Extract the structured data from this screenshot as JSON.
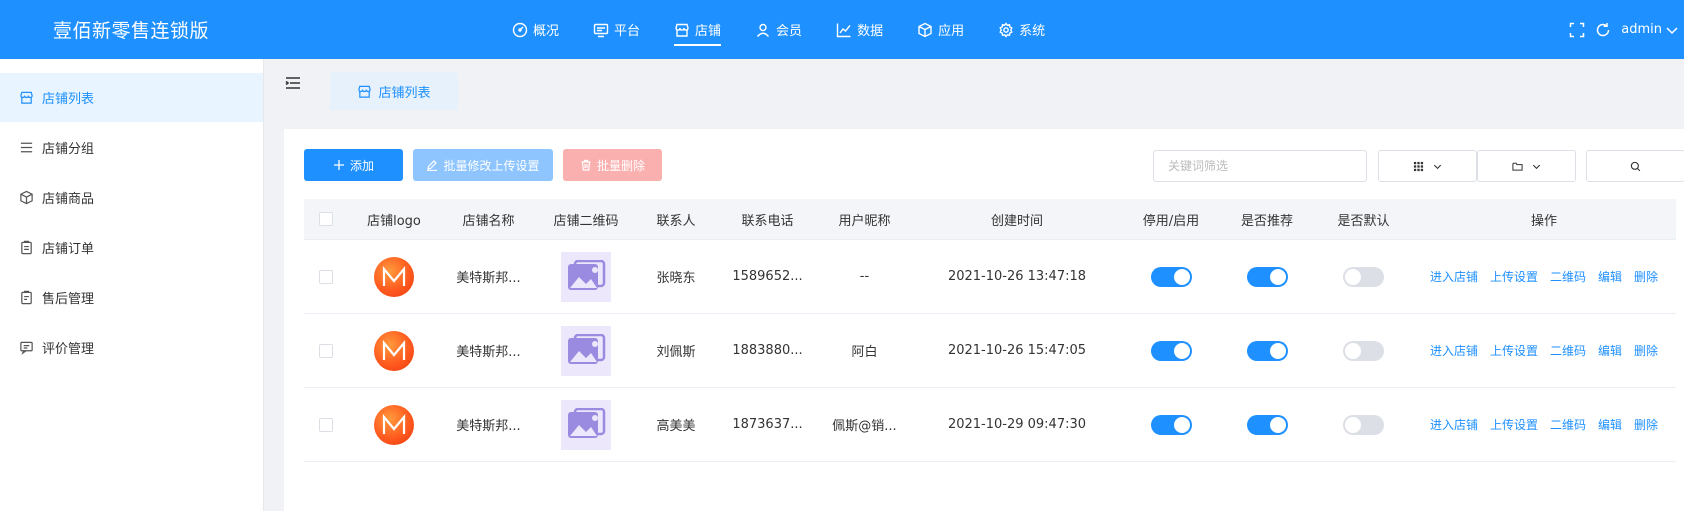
{
  "app": {
    "title": "壹佰新零售连锁版",
    "accent": "#1e90ff"
  },
  "topnav": [
    {
      "label": "概况",
      "icon": "dashboard-icon"
    },
    {
      "label": "平台",
      "icon": "monitor-icon"
    },
    {
      "label": "店铺",
      "icon": "store-icon",
      "active": true
    },
    {
      "label": "会员",
      "icon": "user-icon"
    },
    {
      "label": "数据",
      "icon": "chart-line-icon"
    },
    {
      "label": "应用",
      "icon": "cube-icon"
    },
    {
      "label": "系统",
      "icon": "gear-icon"
    }
  ],
  "header_right": {
    "user": "admin"
  },
  "sidebar": {
    "items": [
      {
        "label": "店铺列表",
        "icon": "store-icon",
        "active": true
      },
      {
        "label": "店铺分组",
        "icon": "list-icon"
      },
      {
        "label": "店铺商品",
        "icon": "cube-icon"
      },
      {
        "label": "店铺订单",
        "icon": "clipboard-icon"
      },
      {
        "label": "售后管理",
        "icon": "clipboard-icon"
      },
      {
        "label": "评价管理",
        "icon": "comment-icon"
      }
    ]
  },
  "tabs": [
    {
      "label": "店铺列表",
      "icon": "store-icon"
    }
  ],
  "toolbar": {
    "add_label": "添加",
    "batch_upload_label": "批量修改上传设置",
    "batch_delete_label": "批量删除",
    "search_placeholder": "关键词筛选"
  },
  "table": {
    "headers": [
      "店铺logo",
      "店铺名称",
      "店铺二维码",
      "联系人",
      "联系电话",
      "用户昵称",
      "创建时间",
      "停用/启用",
      "是否推荐",
      "是否默认",
      "操作"
    ],
    "rows": [
      {
        "name": "美特斯邦...",
        "contact": "张晓东",
        "phone": "1589652...",
        "nickname": "--",
        "created": "2021-10-26 13:47:18",
        "enabled": true,
        "recommended": true,
        "default": false
      },
      {
        "name": "美特斯邦...",
        "contact": "刘佩斯",
        "phone": "1883880...",
        "nickname": "阿白",
        "created": "2021-10-26 15:47:05",
        "enabled": true,
        "recommended": true,
        "default": false
      },
      {
        "name": "美特斯邦...",
        "contact": "高美美",
        "phone": "1873637...",
        "nickname": "佩斯@销...",
        "created": "2021-10-29 09:47:30",
        "enabled": true,
        "recommended": true,
        "default": false
      }
    ],
    "ops": [
      "进入店铺",
      "上传设置",
      "二维码",
      "编辑",
      "删除"
    ]
  }
}
